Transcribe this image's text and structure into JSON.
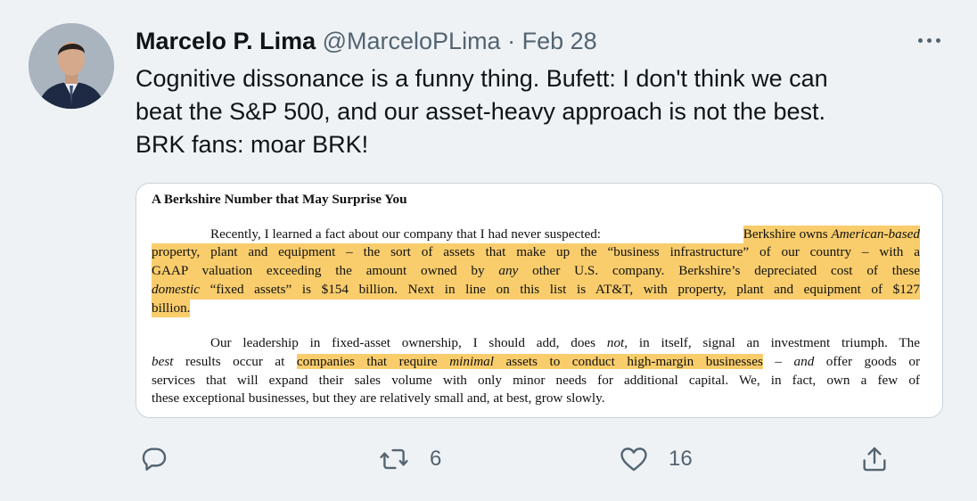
{
  "tweet": {
    "display_name": "Marcelo P. Lima",
    "handle": "@MarceloPLima",
    "separator": "·",
    "date": "Feb 28",
    "text_lines": [
      "Cognitive dissonance is a funny thing. Bufett: I don't think we can",
      "beat the S&P 500, and our asset-heavy approach is not the best.",
      "BRK fans: moar BRK!"
    ]
  },
  "document": {
    "heading": "A Berkshire Number that May Surprise You",
    "p1": {
      "l1_a": "Recently, I learned a fact about our company that I had never suspected: ",
      "l1_hl_a": "Berkshire owns ",
      "l1_hl_em": "American-based",
      "l2": "property, plant and equipment – the sort of assets that make up the “business infrastructure” of our country – with a",
      "l3_a": "GAAP valuation exceeding the amount owned by ",
      "l3_em": "any",
      "l3_b": " other U.S. company. Berkshire’s depreciated cost of these",
      "l4_em": "domestic",
      "l4_b": " “fixed assets” is $154 billion. Next in line on this list is AT&T, with property, plant and equipment of $127",
      "l5": "billion."
    },
    "p2": {
      "l1_a": "Our leadership in fixed-asset ownership, I should add, does ",
      "l1_em": "not",
      "l1_b": ", in itself, signal an investment triumph. The",
      "l2_em": "best",
      "l2_a": " results occur at ",
      "l2_hl_a": "companies that require ",
      "l2_hl_em": "minimal",
      "l2_hl_b": " assets to conduct high-margin businesses",
      "l2_b": " – ",
      "l2_em2": "and",
      "l2_c": " offer goods or",
      "l3": "services that will expand their sales volume with only minor needs for additional capital. We, in fact, own a few of",
      "l4": "these exceptional businesses, but they are relatively small and, at best, grow slowly."
    }
  },
  "actions": {
    "reply_icon": "reply-icon",
    "retweet_icon": "retweet-icon",
    "retweet_count": "6",
    "like_icon": "heart-icon",
    "like_count": "16",
    "share_icon": "share-icon"
  },
  "colors": {
    "background": "#eff2f5",
    "text": "#0f1419",
    "secondary_text": "#536471",
    "highlight": "#f9cd6c",
    "card_border": "#c8d3dc"
  }
}
